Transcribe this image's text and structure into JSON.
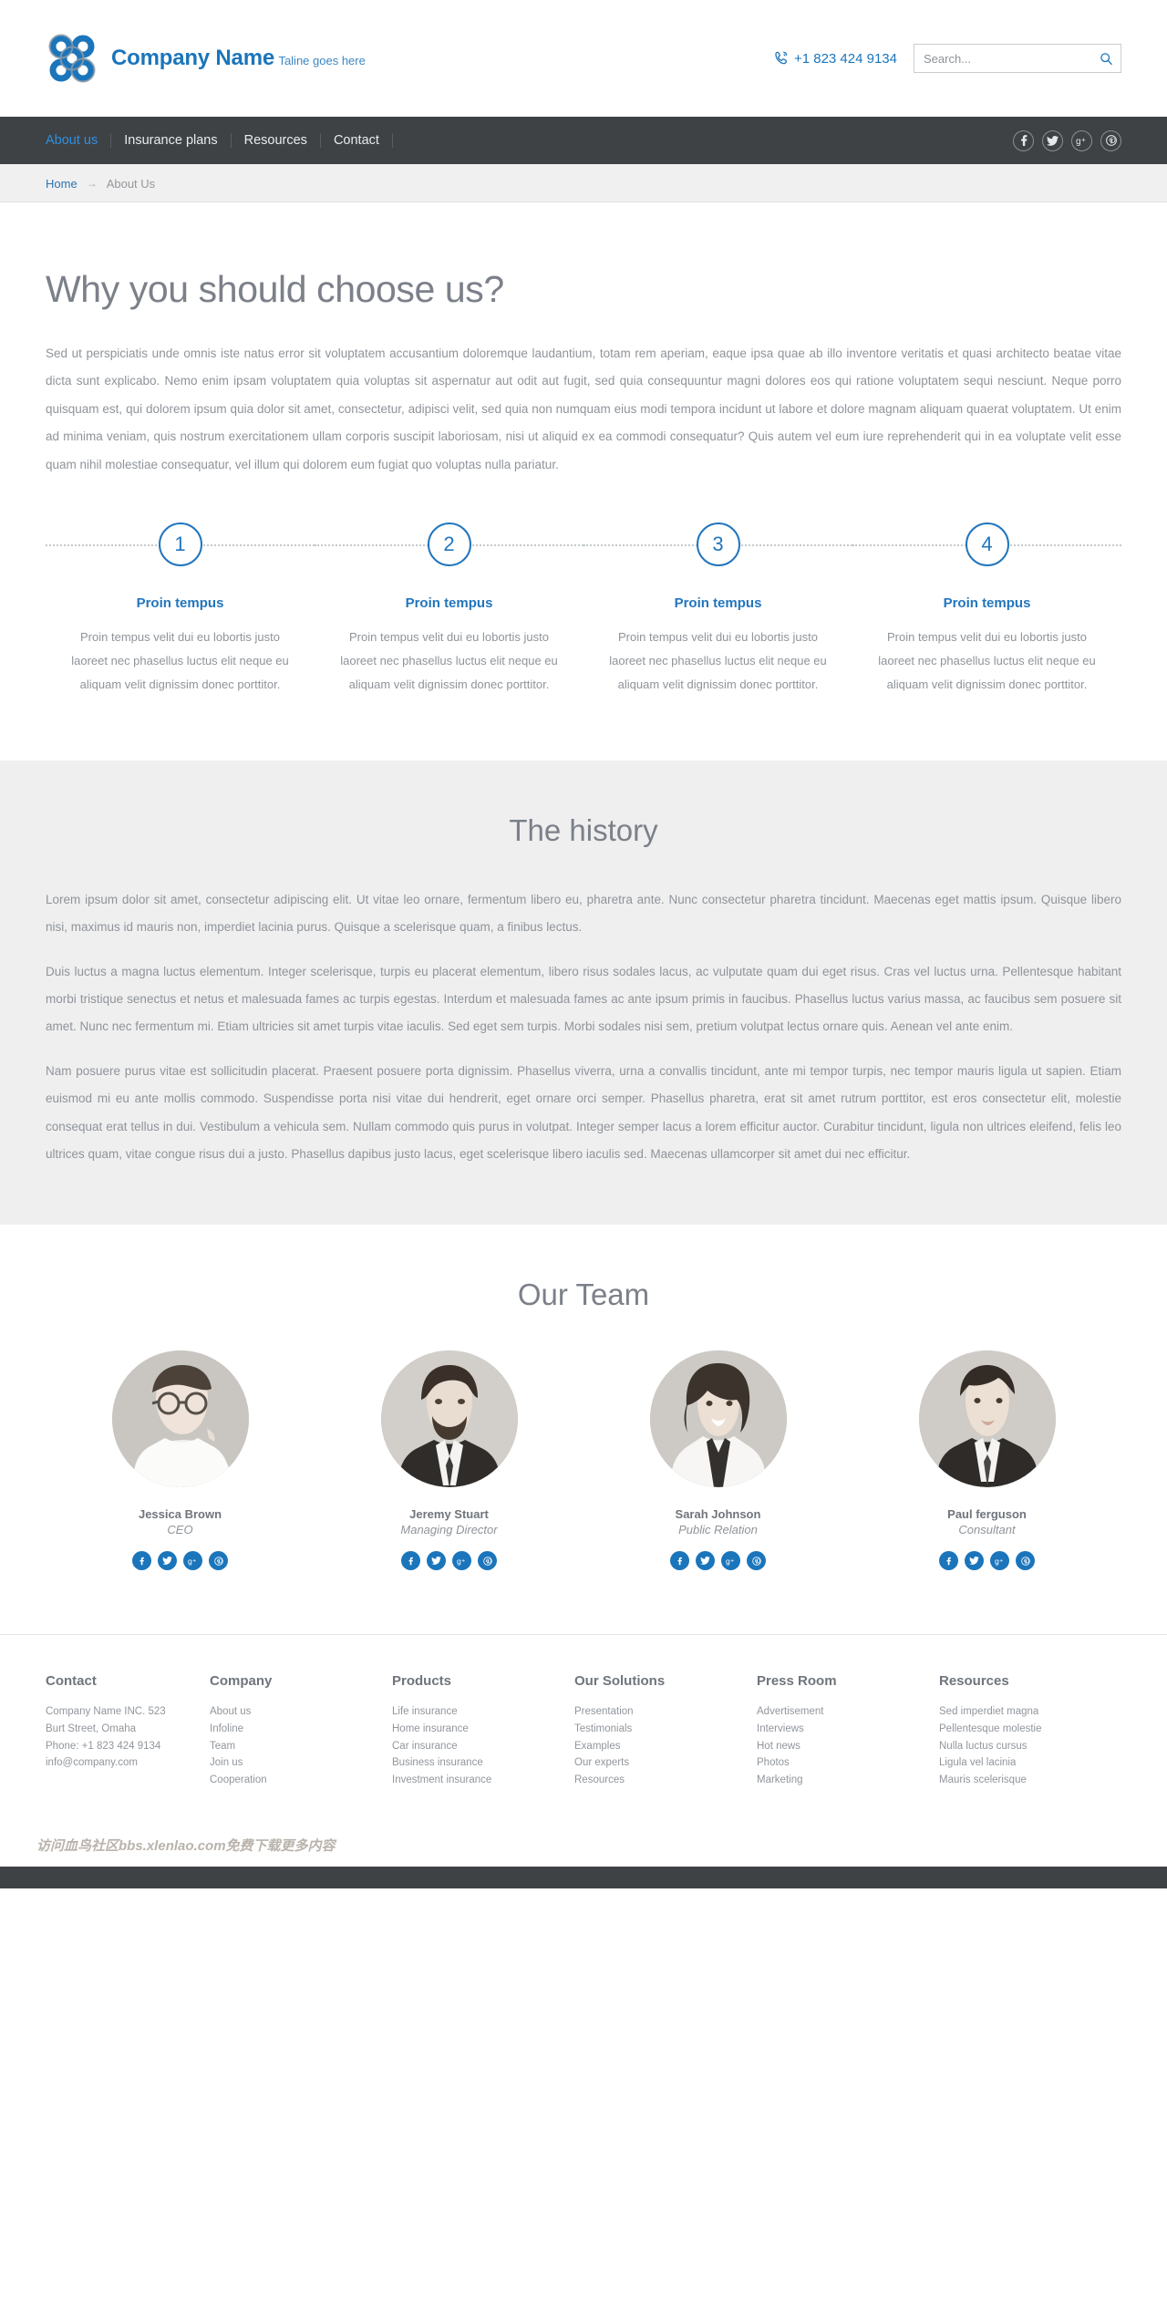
{
  "header": {
    "brand_name": "Company Name",
    "brand_tagline": "Taline goes here",
    "logo_icon": "flower-knot-logo",
    "phone_icon": "phone-ring-icon",
    "phone": "+1 823 424 9134",
    "search_placeholder": "Search...",
    "search_value": "",
    "search_icon": "search-icon"
  },
  "nav": {
    "items": [
      {
        "label": "About us",
        "active": true
      },
      {
        "label": "Insurance plans",
        "active": false
      },
      {
        "label": "Resources",
        "active": false
      },
      {
        "label": "Contact",
        "active": false
      }
    ],
    "social": [
      {
        "name": "facebook",
        "glyph": "f"
      },
      {
        "name": "twitter",
        "glyph": "t"
      },
      {
        "name": "googleplus",
        "glyph": "g+"
      },
      {
        "name": "pinterest",
        "glyph": "p"
      }
    ]
  },
  "breadcrumb": {
    "home": "Home",
    "separator": "→",
    "current": "About Us"
  },
  "why": {
    "title": "Why you should choose us?",
    "lead": "Sed ut perspiciatis unde omnis iste natus error sit voluptatem accusantium doloremque laudantium, totam rem aperiam, eaque ipsa quae ab illo inventore veritatis et quasi architecto beatae vitae dicta sunt explicabo. Nemo enim ipsam voluptatem quia voluptas sit aspernatur aut odit aut fugit, sed quia consequuntur magni dolores eos qui ratione voluptatem sequi nesciunt. Neque porro quisquam est, qui dolorem ipsum quia dolor sit amet, consectetur, adipisci velit, sed quia non numquam eius modi tempora incidunt ut labore et dolore magnam aliquam quaerat voluptatem. Ut enim ad minima veniam, quis nostrum exercitationem ullam corporis suscipit laboriosam, nisi ut aliquid ex ea commodi consequatur? Quis autem vel eum iure reprehenderit qui in ea voluptate velit esse quam nihil molestiae consequatur, vel illum qui dolorem eum fugiat quo voluptas nulla pariatur.",
    "steps": [
      {
        "number": "1",
        "title": "Proin tempus",
        "text": "Proin tempus velit dui eu lobortis justo laoreet nec phasellus luctus elit neque eu aliquam velit dignissim donec porttitor."
      },
      {
        "number": "2",
        "title": "Proin tempus",
        "text": "Proin tempus velit dui eu lobortis justo laoreet nec phasellus luctus elit neque eu aliquam velit dignissim donec porttitor."
      },
      {
        "number": "3",
        "title": "Proin tempus",
        "text": "Proin tempus velit dui eu lobortis justo laoreet nec phasellus luctus elit neque eu aliquam velit dignissim donec porttitor."
      },
      {
        "number": "4",
        "title": "Proin tempus",
        "text": "Proin tempus velit dui eu lobortis justo laoreet nec phasellus luctus elit neque eu aliquam velit dignissim donec porttitor."
      }
    ]
  },
  "history": {
    "title": "The history",
    "paragraphs": [
      "Lorem ipsum dolor sit amet, consectetur adipiscing elit. Ut vitae leo ornare, fermentum libero eu, pharetra ante. Nunc consectetur pharetra tincidunt. Maecenas eget mattis ipsum. Quisque libero nisi, maximus id mauris non, imperdiet lacinia purus. Quisque a scelerisque quam, a finibus lectus.",
      "Duis luctus a magna luctus elementum. Integer scelerisque, turpis eu placerat elementum, libero risus sodales lacus, ac vulputate quam dui eget risus. Cras vel luctus urna. Pellentesque habitant morbi tristique senectus et netus et malesuada fames ac turpis egestas. Interdum et malesuada fames ac ante ipsum primis in faucibus. Phasellus luctus varius massa, ac faucibus sem posuere sit amet. Nunc nec fermentum mi. Etiam ultricies sit amet turpis vitae iaculis. Sed eget sem turpis. Morbi sodales nisi sem, pretium volutpat lectus ornare quis. Aenean vel ante enim.",
      "Nam posuere purus vitae est sollicitudin placerat. Praesent posuere porta dignissim. Phasellus viverra, urna a convallis tincidunt, ante mi tempor turpis, nec tempor mauris ligula ut sapien. Etiam euismod mi eu ante mollis commodo. Suspendisse porta nisi vitae dui hendrerit, eget ornare orci semper. Phasellus pharetra, erat sit amet rutrum porttitor, est eros consectetur elit, molestie consequat erat tellus in dui. Vestibulum a vehicula sem. Nullam commodo quis purus in volutpat. Integer semper lacus a lorem efficitur auctor. Curabitur tincidunt, ligula non ultrices eleifend, felis leo ultrices quam, vitae congue risus dui a justo. Phasellus dapibus justo lacus, eget scelerisque libero iaculis sed. Maecenas ullamcorper sit amet dui nec efficitur."
    ]
  },
  "team": {
    "title": "Our Team",
    "members": [
      {
        "name": "Jessica Brown",
        "role": "CEO",
        "photo": "woman-glasses-portrait"
      },
      {
        "name": "Jeremy Stuart",
        "role": "Managing Director",
        "photo": "man-beard-portrait"
      },
      {
        "name": "Sarah Johnson",
        "role": "Public Relation",
        "photo": "woman-curly-portrait"
      },
      {
        "name": "Paul ferguson",
        "role": "Consultant",
        "photo": "man-suit-portrait"
      }
    ],
    "social": [
      {
        "name": "facebook",
        "glyph": "f"
      },
      {
        "name": "twitter",
        "glyph": "t"
      },
      {
        "name": "googleplus",
        "glyph": "g+"
      },
      {
        "name": "pinterest",
        "glyph": "p"
      }
    ]
  },
  "footer": {
    "columns": [
      {
        "heading": "Contact",
        "items": [
          "Company Name INC. 523",
          "Burt Street, Omaha",
          "Phone: +1 823 424 9134",
          "info@company.com"
        ]
      },
      {
        "heading": "Company",
        "items": [
          "About us",
          "Infoline",
          "Team",
          "Join us",
          "Cooperation"
        ]
      },
      {
        "heading": "Products",
        "items": [
          "Life insurance",
          "Home insurance",
          "Car insurance",
          "Business insurance",
          "Investment insurance"
        ]
      },
      {
        "heading": "Our Solutions",
        "items": [
          "Presentation",
          "Testimonials",
          "Examples",
          "Our experts",
          "Resources"
        ]
      },
      {
        "heading": "Press Room",
        "items": [
          "Advertisement",
          "Interviews",
          "Hot news",
          "Photos",
          "Marketing"
        ]
      },
      {
        "heading": "Resources",
        "items": [
          "Sed imperdiet magna",
          "Pellentesque molestie",
          "Nulla luctus cursus",
          "Ligula vel lacinia",
          "Mauris scelerisque"
        ]
      }
    ]
  },
  "watermark": {
    "text": "访问血鸟社区bbs.xlenlao.com免费下载更多内容"
  },
  "colors": {
    "brand_blue": "#1b75bb",
    "nav_dark": "#3f4245",
    "accent_link": "#2f8fe0",
    "body_gray": "#8f949a",
    "section_gray": "#efefef"
  }
}
